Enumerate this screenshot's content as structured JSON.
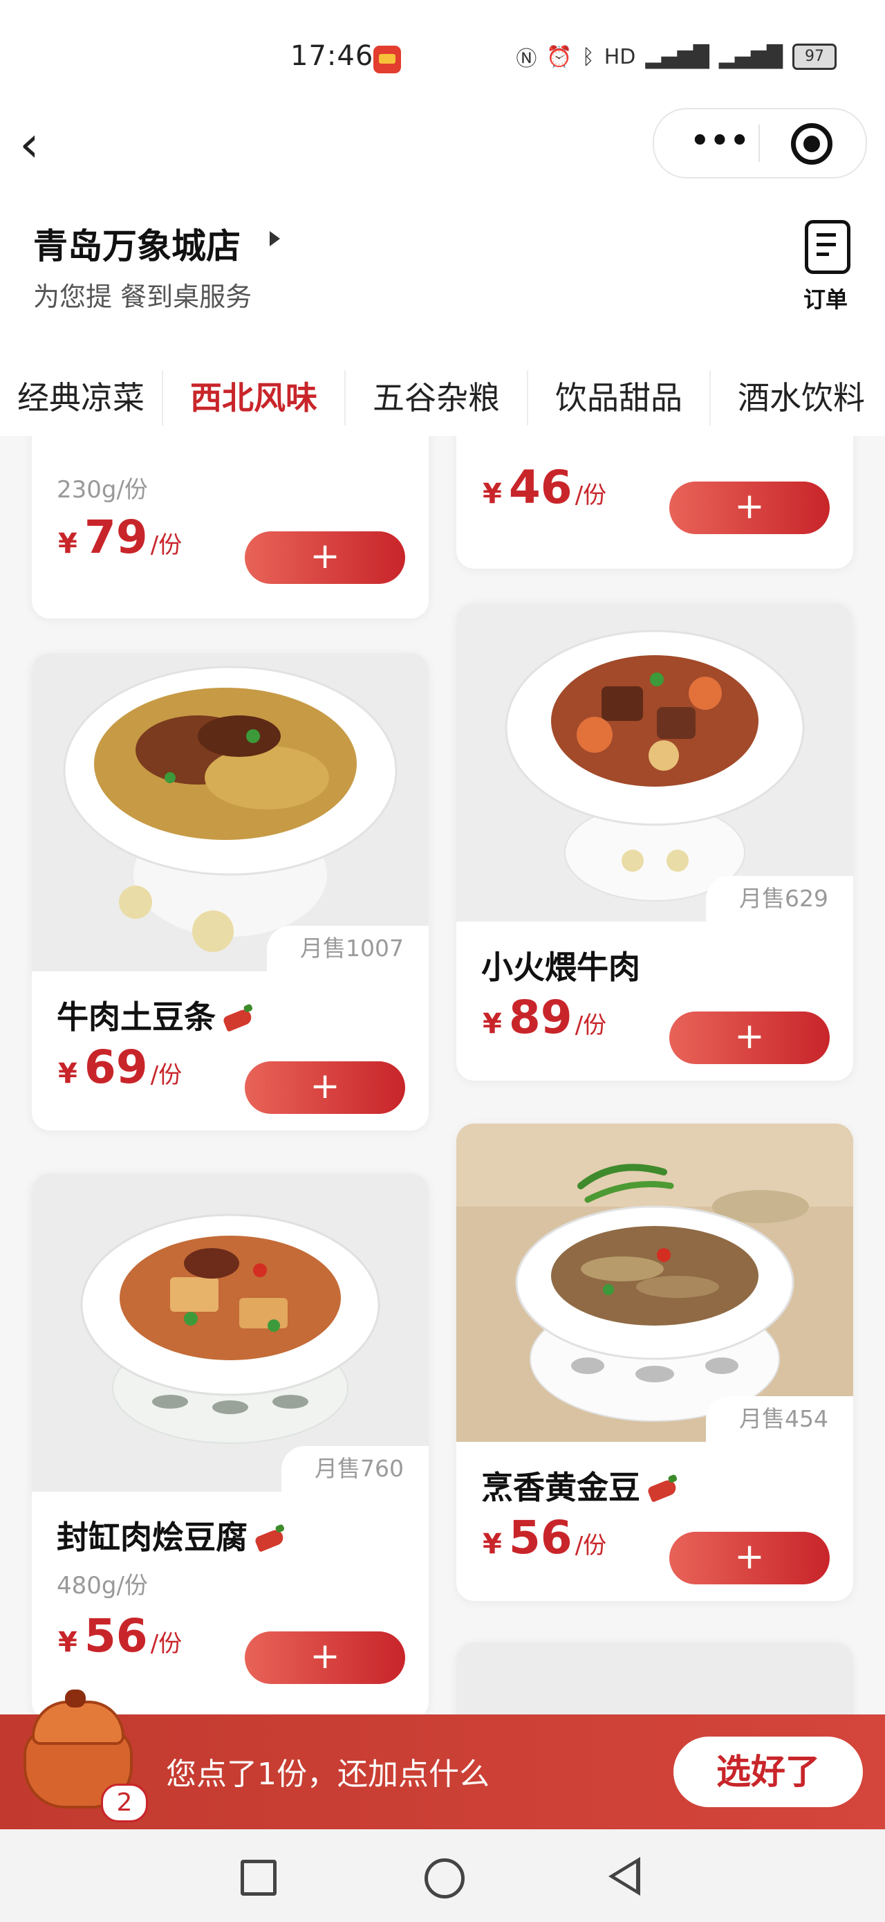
{
  "status_bar": {
    "time": "17:46",
    "icons": [
      "nfc-icon",
      "alarm-icon",
      "bluetooth-icon",
      "hd-icon",
      "signal-4g-icon",
      "signal-5g-icon"
    ],
    "battery": "97"
  },
  "header": {
    "store_name": "青岛万象城店",
    "store_subtitle": "为您提      餐到桌服务",
    "order_label": "订单"
  },
  "tabs": [
    {
      "label": "经典凉菜",
      "active": false
    },
    {
      "label": "西北风味",
      "active": true
    },
    {
      "label": "五谷杂粮",
      "active": false
    },
    {
      "label": "饮品甜品",
      "active": false
    },
    {
      "label": "酒水饮料",
      "active": false
    }
  ],
  "dishes": [
    {
      "name": "",
      "spec": "230g/份",
      "price": "79",
      "currency": "¥",
      "unit": "/份",
      "sold": ""
    },
    {
      "name": "",
      "spec": "",
      "price": "46",
      "currency": "¥",
      "unit": "/份",
      "sold": ""
    },
    {
      "name": "牛肉土豆条",
      "spec": "",
      "price": "69",
      "currency": "¥",
      "unit": "/份",
      "sold": "月售1007",
      "spicy": true
    },
    {
      "name": "小火煨牛肉",
      "spec": "",
      "price": "89",
      "currency": "¥",
      "unit": "/份",
      "sold": "月售629",
      "spicy": false
    },
    {
      "name": "封缸肉烩豆腐",
      "spec": "480g/份",
      "price": "56",
      "currency": "¥",
      "unit": "/份",
      "sold": "月售760",
      "spicy": true
    },
    {
      "name": "烹香黄金豆",
      "spec": "",
      "price": "56",
      "currency": "¥",
      "unit": "/份",
      "sold": "月售454",
      "spicy": true
    }
  ],
  "add_button_label": "+",
  "cart": {
    "message": "您点了1份，还加点什么",
    "badge": "2",
    "choose_label": "选好了"
  },
  "colors": {
    "accent": "#c8252a",
    "cart_bar": "#c23a2f"
  }
}
